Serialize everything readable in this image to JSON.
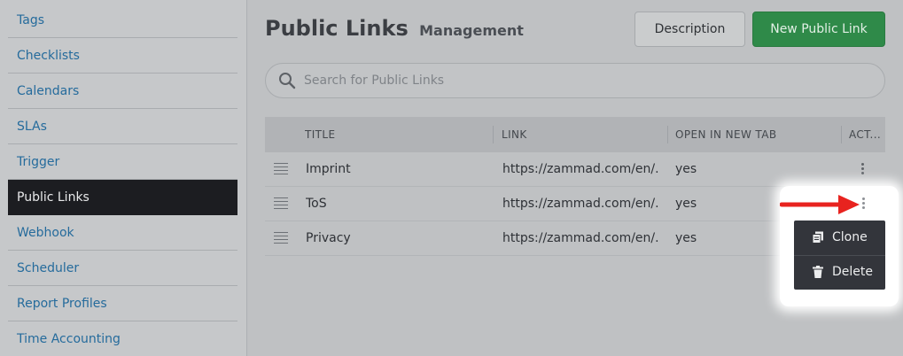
{
  "sidebar": {
    "items": [
      {
        "label": "Tags"
      },
      {
        "label": "Checklists"
      },
      {
        "label": "Calendars"
      },
      {
        "label": "SLAs"
      },
      {
        "label": "Trigger"
      },
      {
        "label": "Public Links",
        "active": true
      },
      {
        "label": "Webhook"
      },
      {
        "label": "Scheduler"
      },
      {
        "label": "Report Profiles"
      },
      {
        "label": "Time Accounting"
      }
    ]
  },
  "header": {
    "title": "Public Links",
    "subtitle": "Management",
    "description_button": "Description",
    "new_button": "New Public Link"
  },
  "search": {
    "placeholder": "Search for Public Links",
    "icon": "search-icon"
  },
  "table": {
    "columns": [
      "TITLE",
      "LINK",
      "OPEN IN NEW TAB",
      "ACT..."
    ],
    "rows": [
      {
        "title": "Imprint",
        "link": "https://zammad.com/en/...",
        "open_in_new_tab": "yes"
      },
      {
        "title": "ToS",
        "link": "https://zammad.com/en/...",
        "open_in_new_tab": "yes"
      },
      {
        "title": "Privacy",
        "link": "https://zammad.com/en/...",
        "open_in_new_tab": "yes"
      }
    ]
  },
  "actions_menu": {
    "items": [
      {
        "label": "Clone",
        "icon": "clone-icon"
      },
      {
        "label": "Delete",
        "icon": "trash-icon"
      }
    ]
  },
  "colors": {
    "primary_button": "#2f8a49",
    "active_sidebar": "#1c1d21",
    "link_text": "#256b9c",
    "arrow": "#e8231f"
  }
}
